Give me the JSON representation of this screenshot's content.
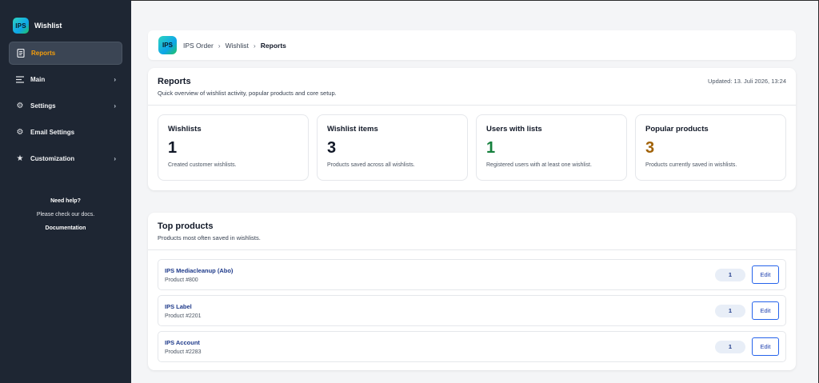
{
  "sidebar": {
    "logo_text": "IPS",
    "brand": "Wishlist",
    "items": [
      {
        "label": "Reports",
        "icon": "document-icon",
        "active": true,
        "chevron": false
      },
      {
        "label": "Main",
        "icon": "list-icon",
        "active": false,
        "chevron": true
      },
      {
        "label": "Settings",
        "icon": "gear-icon",
        "active": false,
        "chevron": true
      },
      {
        "label": "Email Settings",
        "icon": "gear-icon",
        "active": false,
        "chevron": false
      },
      {
        "label": "Customization",
        "icon": "star-icon",
        "active": false,
        "chevron": true
      }
    ],
    "help": {
      "title": "Need help?",
      "text": "Please check our docs.",
      "link": "Documentation"
    }
  },
  "breadcrumb": {
    "logo_text": "IPS",
    "items": [
      "IPS Order",
      "Wishlist",
      "Reports"
    ],
    "separator": "›"
  },
  "reports": {
    "title": "Reports",
    "subtitle": "Quick overview of wishlist activity, popular products and core setup.",
    "updated": "Updated: 13. Juli 2026, 13:24",
    "stats": [
      {
        "label": "Wishlists",
        "value": "1",
        "desc": "Created customer wishlists.",
        "color": "#111827"
      },
      {
        "label": "Wishlist items",
        "value": "3",
        "desc": "Products saved across all wishlists.",
        "color": "#111827"
      },
      {
        "label": "Users with lists",
        "value": "1",
        "desc": "Registered users with at least one wishlist.",
        "color": "#15803d"
      },
      {
        "label": "Popular products",
        "value": "3",
        "desc": "Products currently saved in wishlists.",
        "color": "#a16207"
      }
    ]
  },
  "top_products": {
    "title": "Top products",
    "subtitle": "Products most often saved in wishlists.",
    "edit_label": "Edit",
    "rows": [
      {
        "name": "IPS Mediacleanup (Abo)",
        "id": "Product #800",
        "count": "1"
      },
      {
        "name": "IPS Label",
        "id": "Product #2201",
        "count": "1"
      },
      {
        "name": "IPS Account",
        "id": "Product #2283",
        "count": "1"
      }
    ]
  },
  "colors": {
    "sidebar_bg": "#1e2633",
    "active_accent": "#f59e0b",
    "link": "#1e3a8a",
    "edit_border": "#2563eb"
  }
}
